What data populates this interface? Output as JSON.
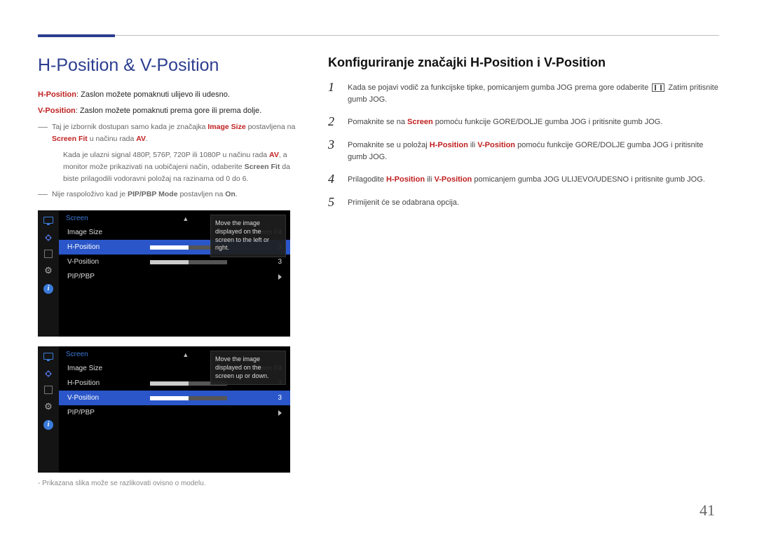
{
  "page_number": "41",
  "title": "H-Position & V-Position",
  "defs": {
    "hpos_k": "H-Position",
    "hpos_v": ": Zaslon možete pomaknuti ulijevo ili udesno.",
    "vpos_k": "V-Position",
    "vpos_v": ": Zaslon možete pomaknuti prema gore ili prema dolje."
  },
  "note1": {
    "pre": "Taj je izbornik dostupan samo kada je značajka ",
    "b1": "Image Size",
    "mid": " postavljena na ",
    "b2": "Screen Fit",
    "mid2": " u načinu rada ",
    "b3": "AV",
    "post": "."
  },
  "note1_sub": {
    "pre": "Kada je ulazni signal 480P, 576P, 720P ili 1080P u načinu rada ",
    "b1": "AV",
    "mid": ", a monitor može prikazivati na uobičajeni način, odaberite ",
    "b2": "Screen Fit",
    "post": " da biste prilagodili vodoravni položaj na razinama od 0 do 6."
  },
  "note2": {
    "pre": "Nije raspoloživo kad je ",
    "b1": "PIP/PBP Mode",
    "mid": " postavljen na ",
    "b2": "On",
    "post": "."
  },
  "caption": "Prikazana slika može se razlikovati ovisno o modelu.",
  "right_title": "Konfiguriranje značajki H-Position i V-Position",
  "steps": [
    {
      "n": "1",
      "pre": "Kada se pojavi vodič za funkcijske tipke, pomicanjem gumba JOG prema gore odaberite ",
      "icon": true,
      "post": " Zatim pritisnite gumb JOG."
    },
    {
      "n": "2",
      "pre": "Pomaknite se na ",
      "hl": "Screen",
      "post": " pomoću funkcije GORE/DOLJE gumba JOG i pritisnite gumb JOG."
    },
    {
      "n": "3",
      "pre": "Pomaknite se u položaj ",
      "hl": "H-Position",
      "mid": " ili ",
      "hl2": "V-Position",
      "post": " pomoću funkcije GORE/DOLJE gumba JOG i pritisnite gumb JOG."
    },
    {
      "n": "4",
      "pre": "Prilagodite ",
      "hl": "H-Position",
      "mid": " ili ",
      "hl2": "V-Position",
      "post": " pomicanjem gumba JOG ULIJEVO/UDESNO i pritisnite gumb JOG."
    },
    {
      "n": "5",
      "pre": "Primijenit će se odabrana opcija."
    }
  ],
  "osd": {
    "title": "Screen",
    "rows": {
      "imagesize_l": "Image Size",
      "imagesize_v": "Screen Fit",
      "hpos_l": "H-Position",
      "hpos_v": "3",
      "vpos_l": "V-Position",
      "vpos_v": "3",
      "pip_l": "PIP/PBP"
    },
    "tip1": "Move the image displayed on the screen to the left or right.",
    "tip2": "Move the image displayed on the screen up or down."
  }
}
